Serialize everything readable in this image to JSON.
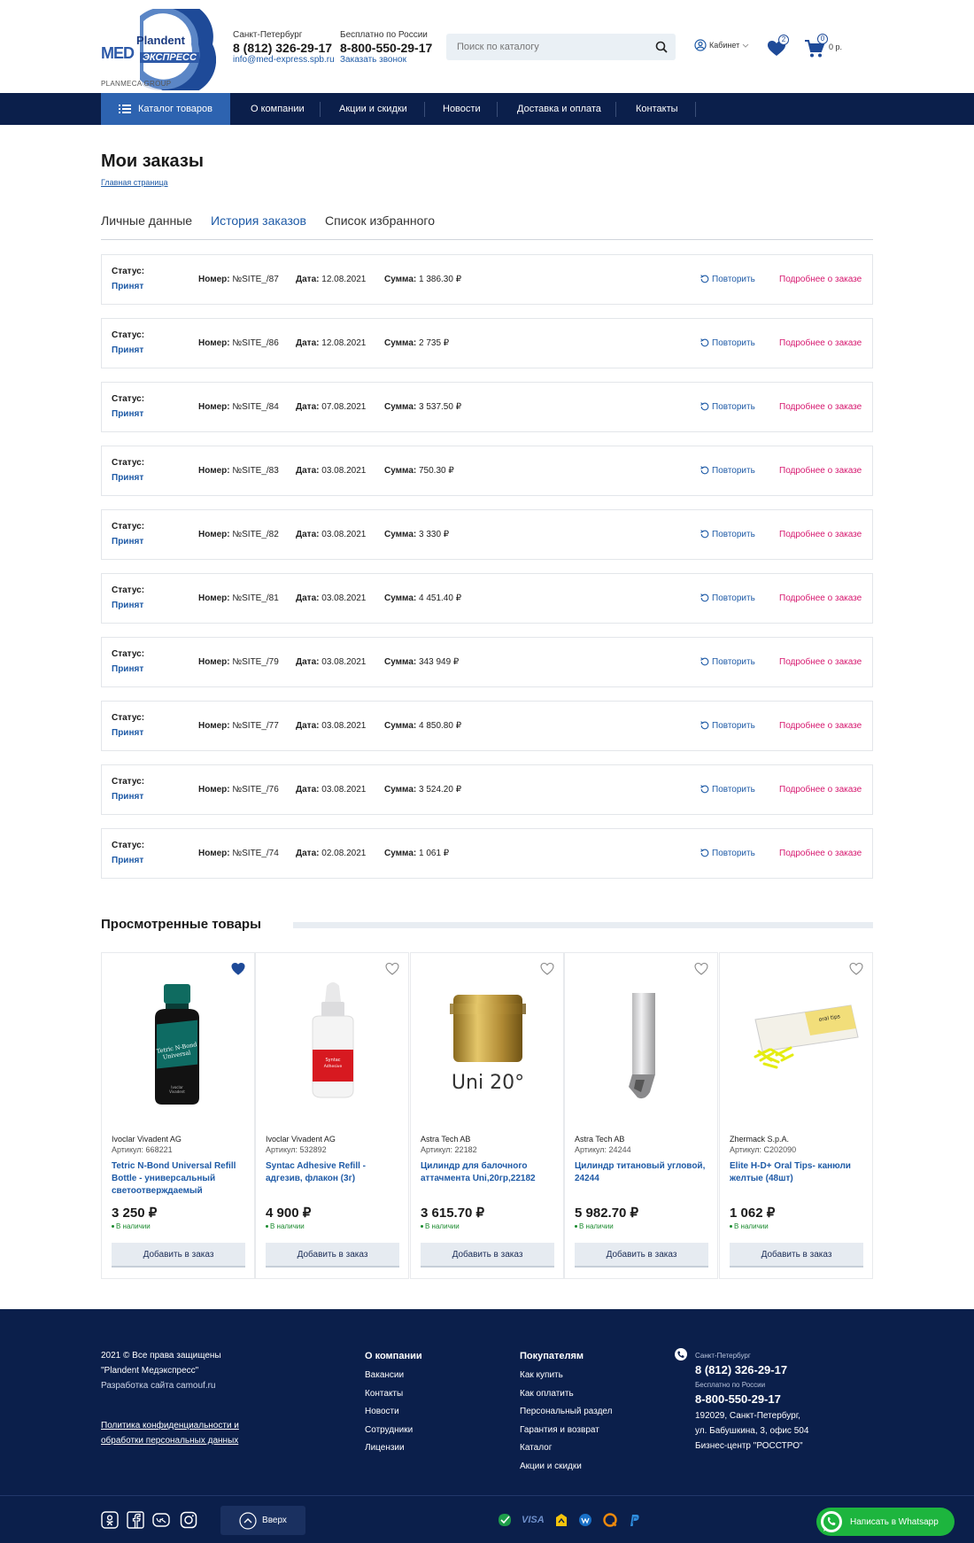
{
  "header": {
    "logo": {
      "plandent": "Plandent",
      "med": "MED",
      "express": "ЭКСПРЕСС",
      "group": "PLANMECA GROUP"
    },
    "spb": {
      "label": "Санкт-Петербург",
      "phone": "8 (812) 326-29-17",
      "email": "info@med-express.spb.ru"
    },
    "russia": {
      "label": "Бесплатно по России",
      "phone": "8-800-550-29-17",
      "callback": "Заказать звонок"
    },
    "search_placeholder": "Поиск по каталогу",
    "cabinet": "Кабинет",
    "favorites_count": "2",
    "cart_count": "0",
    "cart_sum": "0 р."
  },
  "nav": {
    "catalog": "Каталог товаров",
    "items": [
      "О компании",
      "Акции и скидки",
      "Новости",
      "Доставка и оплата",
      "Контакты"
    ]
  },
  "page": {
    "title": "Мои заказы",
    "breadcrumb": "Главная страница",
    "tabs": [
      "Личные данные",
      "История заказов",
      "Список избранного"
    ]
  },
  "order_labels": {
    "status": "Статус:",
    "number": "Номер:",
    "date": "Дата:",
    "sum": "Сумма:",
    "repeat": "Повторить",
    "details": "Подробнее о заказе"
  },
  "orders": [
    {
      "status": "Принят",
      "number": "№SITE_/87",
      "date": "12.08.2021",
      "sum": "1 386.30 ₽"
    },
    {
      "status": "Принят",
      "number": "№SITE_/86",
      "date": "12.08.2021",
      "sum": "2 735 ₽"
    },
    {
      "status": "Принят",
      "number": "№SITE_/84",
      "date": "07.08.2021",
      "sum": "3 537.50 ₽"
    },
    {
      "status": "Принят",
      "number": "№SITE_/83",
      "date": "03.08.2021",
      "sum": "750.30 ₽"
    },
    {
      "status": "Принят",
      "number": "№SITE_/82",
      "date": "03.08.2021",
      "sum": "3 330 ₽"
    },
    {
      "status": "Принят",
      "number": "№SITE_/81",
      "date": "03.08.2021",
      "sum": "4 451.40 ₽"
    },
    {
      "status": "Принят",
      "number": "№SITE_/79",
      "date": "03.08.2021",
      "sum": "343 949 ₽"
    },
    {
      "status": "Принят",
      "number": "№SITE_/77",
      "date": "03.08.2021",
      "sum": "4 850.80 ₽"
    },
    {
      "status": "Принят",
      "number": "№SITE_/76",
      "date": "03.08.2021",
      "sum": "3 524.20 ₽"
    },
    {
      "status": "Принят",
      "number": "№SITE_/74",
      "date": "02.08.2021",
      "sum": "1 061 ₽"
    }
  ],
  "viewed": {
    "title": "Просмотренные товары",
    "add_label": "Добавить в заказ",
    "in_stock": "В наличии",
    "products": [
      {
        "brand": "Ivoclar Vivadent AG",
        "article": "Артикул: 668221",
        "name": "Tetric N-Bond Universal Refill Bottle - универсальный светоотверждаемый",
        "price": "3 250 ₽",
        "favorite": true,
        "img_text": [
          "Tetric N-Bond",
          "Universal",
          "Ivoclar",
          "Vivadent"
        ]
      },
      {
        "brand": "Ivoclar Vivadent AG",
        "article": "Артикул: 532892",
        "name": "Syntac Adhesive Refill - адгезив, флакон (3г)",
        "price": "4 900 ₽",
        "favorite": false,
        "img_text": [
          "Syntac",
          "Adhesive"
        ]
      },
      {
        "brand": "Astra Tech AB",
        "article": "Артикул: 22182",
        "name": "Цилиндр для балочного аттачмента Uni,20гр,22182",
        "price": "3 615.70 ₽",
        "favorite": false,
        "img_text": [
          "Uni 20°"
        ]
      },
      {
        "brand": "Astra Tech AB",
        "article": "Артикул: 24244",
        "name": "Цилиндр титановый угловой, 24244",
        "price": "5 982.70 ₽",
        "favorite": false,
        "img_text": []
      },
      {
        "brand": "Zhermack S.p.A.",
        "article": "Артикул: C202090",
        "name": "Elite H-D+ Oral Tips- канюли желтые (48шт)",
        "price": "1 062 ₽",
        "favorite": false,
        "img_text": [
          "oral tips"
        ]
      }
    ]
  },
  "footer": {
    "copyright": [
      "2021 © Все права защищены",
      "\"Plandent Медэкспресс\""
    ],
    "dev": "Разработка сайта camouf.ru",
    "policy": [
      "Политика конфиденциальности и",
      "обработки персональных данных"
    ],
    "col1": {
      "title": "О компании",
      "items": [
        "Вакансии",
        "Контакты",
        "Новости",
        "Сотрудники",
        "Лицензии"
      ]
    },
    "col2": {
      "title": "Покупателям",
      "items": [
        "Как купить",
        "Как оплатить",
        "Персональный раздел",
        "Гарантия и возврат",
        "Каталог",
        "Акции и скидки"
      ]
    },
    "contacts": {
      "spb_label": "Санкт-Петербург",
      "spb_phone": "8 (812) 326-29-17",
      "russia_label": "Бесплатно по России",
      "russia_phone": "8-800-550-29-17",
      "address": [
        "192029, Санкт-Петербург,",
        "ул. Бабушкина, 3, офис 504",
        "Бизнес-центр \"РОССТРО\""
      ]
    },
    "up": "Вверх",
    "whatsapp": "Написать в Whatsapp",
    "payments": [
      "VISA"
    ]
  },
  "colors": {
    "navy": "#0b1f4b",
    "accent": "#2d63b0",
    "link": "#1e5aa6",
    "pink": "#d6186f",
    "green": "#1db53e"
  }
}
